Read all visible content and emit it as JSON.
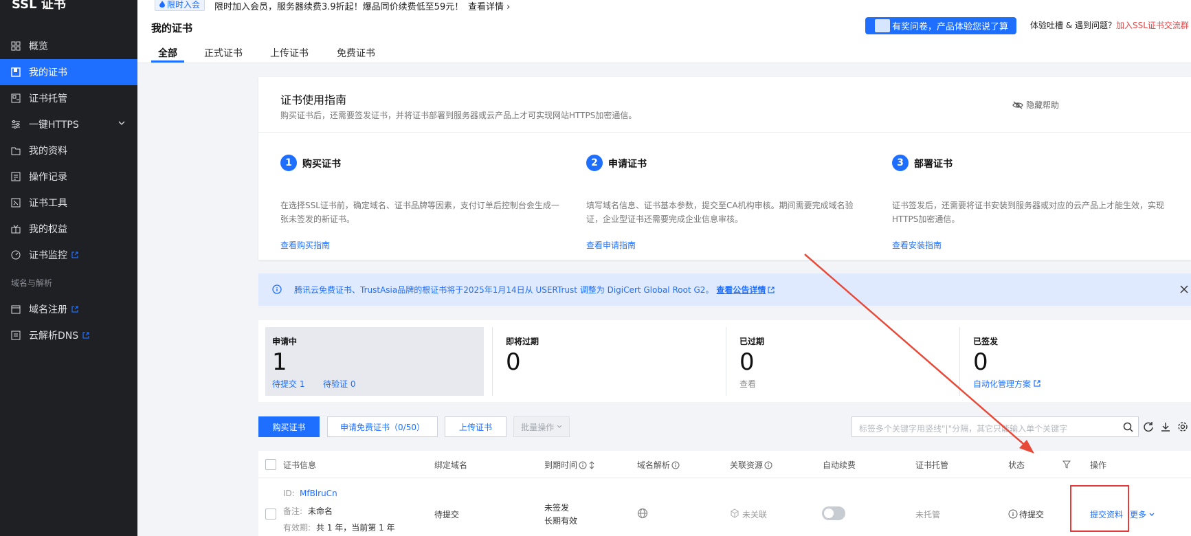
{
  "brand": "SSL 证书",
  "sidebar": {
    "items": [
      {
        "label": "概览",
        "icon": "grid-icon"
      },
      {
        "label": "我的证书",
        "icon": "certificate-icon"
      },
      {
        "label": "证书托管",
        "icon": "hosting-icon"
      },
      {
        "label": "一键HTTPS",
        "icon": "https-icon"
      },
      {
        "label": "我的资料",
        "icon": "folder-icon"
      },
      {
        "label": "操作记录",
        "icon": "log-icon"
      },
      {
        "label": "证书工具",
        "icon": "tool-icon"
      },
      {
        "label": "我的权益",
        "icon": "gift-icon"
      },
      {
        "label": "证书监控",
        "icon": "monitor-icon"
      }
    ],
    "section": "域名与解析",
    "section_items": [
      {
        "label": "域名注册",
        "icon": "domain-icon"
      },
      {
        "label": "云解析DNS",
        "icon": "dns-icon"
      }
    ]
  },
  "top": {
    "badge": "限时入会",
    "promo": "限时加入会员，服务器续费3.9折起！爆品同价续费低至59元！",
    "promo_link": "查看详情"
  },
  "header": {
    "title": "我的证书",
    "survey": "有奖问卷，产品体验您说了算",
    "feedback": "体验吐槽 & 遇到问题？",
    "feedback_link": "加入SSL证书交流群",
    "tabs": [
      "全部",
      "正式证书",
      "上传证书",
      "免费证书"
    ]
  },
  "guide": {
    "title": "证书使用指南",
    "desc": "购买证书后，还需要签发证书，并将证书部署到服务器或云产品上才可实现网站HTTPS加密通信。",
    "hide": "隐藏帮助",
    "steps": [
      {
        "num": "1",
        "title": "购买证书",
        "desc": "在选择SSL证书前，确定域名、证书品牌等因素，支付订单后控制台会生成一张未签发的新证书。",
        "link": "查看购买指南"
      },
      {
        "num": "2",
        "title": "申请证书",
        "desc": "填写域名信息、证书基本参数，提交至CA机构审核。期间需要完成域名验证，企业型证书还需要完成企业信息审核。",
        "link": "查看申请指南"
      },
      {
        "num": "3",
        "title": "部署证书",
        "desc": "证书签发后，还需要将证书安装到服务器或对应的云产品上才能生效，实现HTTPS加密通信。",
        "link": "查看安装指南"
      }
    ]
  },
  "notice": {
    "text": "腾讯云免费证书、TrustAsia品牌的根证书将于2025年1月14日从 USERTrust 调整为 DigiCert Global Root G2。",
    "link": "查看公告详情"
  },
  "stats": [
    {
      "label": "申请中",
      "value": "1",
      "sub1": "待提交 1",
      "sub2": "待验证 0"
    },
    {
      "label": "即将过期",
      "value": "0"
    },
    {
      "label": "已过期",
      "value": "0",
      "sub1": "查看"
    },
    {
      "label": "已签发",
      "value": "0",
      "sub1": "自动化管理方案"
    }
  ],
  "toolbar": {
    "buy": "购买证书",
    "apply_free": "申请免费证书（0/50）",
    "upload": "上传证书",
    "batch": "批量操作",
    "search_placeholder": "标签多个关键字用竖线\"|\"分隔，其它只能输入单个关键字"
  },
  "table": {
    "headers": [
      "证书信息",
      "绑定域名",
      "到期时间",
      "域名解析",
      "关联资源",
      "自动续费",
      "证书托管",
      "状态",
      "操作"
    ],
    "row": {
      "id_label": "ID:",
      "id": "MfBlruCn",
      "note_label": "备注:",
      "note": "未命名",
      "validity_label": "有效期:",
      "validity": "共 1 年，当前第 1 年",
      "domain": "待提交",
      "expire1": "未签发",
      "expire2": "长期有效",
      "resource": "未关联",
      "hosting": "未托管",
      "status": "待提交",
      "action": "提交资料",
      "more": "更多"
    }
  }
}
